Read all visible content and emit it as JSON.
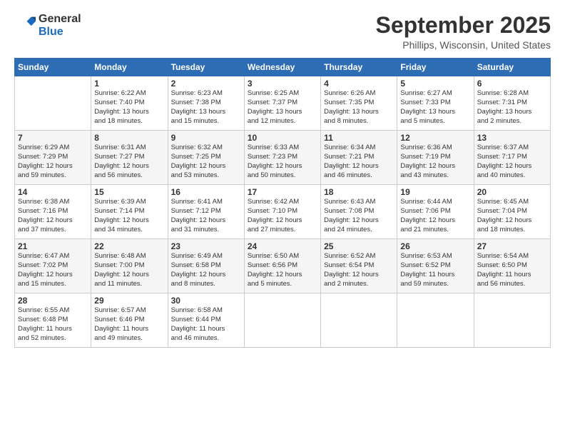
{
  "header": {
    "logo_general": "General",
    "logo_blue": "Blue",
    "month_title": "September 2025",
    "location": "Phillips, Wisconsin, United States"
  },
  "days_of_week": [
    "Sunday",
    "Monday",
    "Tuesday",
    "Wednesday",
    "Thursday",
    "Friday",
    "Saturday"
  ],
  "weeks": [
    [
      {
        "day": "",
        "info": ""
      },
      {
        "day": "1",
        "info": "Sunrise: 6:22 AM\nSunset: 7:40 PM\nDaylight: 13 hours\nand 18 minutes."
      },
      {
        "day": "2",
        "info": "Sunrise: 6:23 AM\nSunset: 7:38 PM\nDaylight: 13 hours\nand 15 minutes."
      },
      {
        "day": "3",
        "info": "Sunrise: 6:25 AM\nSunset: 7:37 PM\nDaylight: 13 hours\nand 12 minutes."
      },
      {
        "day": "4",
        "info": "Sunrise: 6:26 AM\nSunset: 7:35 PM\nDaylight: 13 hours\nand 8 minutes."
      },
      {
        "day": "5",
        "info": "Sunrise: 6:27 AM\nSunset: 7:33 PM\nDaylight: 13 hours\nand 5 minutes."
      },
      {
        "day": "6",
        "info": "Sunrise: 6:28 AM\nSunset: 7:31 PM\nDaylight: 13 hours\nand 2 minutes."
      }
    ],
    [
      {
        "day": "7",
        "info": "Sunrise: 6:29 AM\nSunset: 7:29 PM\nDaylight: 12 hours\nand 59 minutes."
      },
      {
        "day": "8",
        "info": "Sunrise: 6:31 AM\nSunset: 7:27 PM\nDaylight: 12 hours\nand 56 minutes."
      },
      {
        "day": "9",
        "info": "Sunrise: 6:32 AM\nSunset: 7:25 PM\nDaylight: 12 hours\nand 53 minutes."
      },
      {
        "day": "10",
        "info": "Sunrise: 6:33 AM\nSunset: 7:23 PM\nDaylight: 12 hours\nand 50 minutes."
      },
      {
        "day": "11",
        "info": "Sunrise: 6:34 AM\nSunset: 7:21 PM\nDaylight: 12 hours\nand 46 minutes."
      },
      {
        "day": "12",
        "info": "Sunrise: 6:36 AM\nSunset: 7:19 PM\nDaylight: 12 hours\nand 43 minutes."
      },
      {
        "day": "13",
        "info": "Sunrise: 6:37 AM\nSunset: 7:17 PM\nDaylight: 12 hours\nand 40 minutes."
      }
    ],
    [
      {
        "day": "14",
        "info": "Sunrise: 6:38 AM\nSunset: 7:16 PM\nDaylight: 12 hours\nand 37 minutes."
      },
      {
        "day": "15",
        "info": "Sunrise: 6:39 AM\nSunset: 7:14 PM\nDaylight: 12 hours\nand 34 minutes."
      },
      {
        "day": "16",
        "info": "Sunrise: 6:41 AM\nSunset: 7:12 PM\nDaylight: 12 hours\nand 31 minutes."
      },
      {
        "day": "17",
        "info": "Sunrise: 6:42 AM\nSunset: 7:10 PM\nDaylight: 12 hours\nand 27 minutes."
      },
      {
        "day": "18",
        "info": "Sunrise: 6:43 AM\nSunset: 7:08 PM\nDaylight: 12 hours\nand 24 minutes."
      },
      {
        "day": "19",
        "info": "Sunrise: 6:44 AM\nSunset: 7:06 PM\nDaylight: 12 hours\nand 21 minutes."
      },
      {
        "day": "20",
        "info": "Sunrise: 6:45 AM\nSunset: 7:04 PM\nDaylight: 12 hours\nand 18 minutes."
      }
    ],
    [
      {
        "day": "21",
        "info": "Sunrise: 6:47 AM\nSunset: 7:02 PM\nDaylight: 12 hours\nand 15 minutes."
      },
      {
        "day": "22",
        "info": "Sunrise: 6:48 AM\nSunset: 7:00 PM\nDaylight: 12 hours\nand 11 minutes."
      },
      {
        "day": "23",
        "info": "Sunrise: 6:49 AM\nSunset: 6:58 PM\nDaylight: 12 hours\nand 8 minutes."
      },
      {
        "day": "24",
        "info": "Sunrise: 6:50 AM\nSunset: 6:56 PM\nDaylight: 12 hours\nand 5 minutes."
      },
      {
        "day": "25",
        "info": "Sunrise: 6:52 AM\nSunset: 6:54 PM\nDaylight: 12 hours\nand 2 minutes."
      },
      {
        "day": "26",
        "info": "Sunrise: 6:53 AM\nSunset: 6:52 PM\nDaylight: 11 hours\nand 59 minutes."
      },
      {
        "day": "27",
        "info": "Sunrise: 6:54 AM\nSunset: 6:50 PM\nDaylight: 11 hours\nand 56 minutes."
      }
    ],
    [
      {
        "day": "28",
        "info": "Sunrise: 6:55 AM\nSunset: 6:48 PM\nDaylight: 11 hours\nand 52 minutes."
      },
      {
        "day": "29",
        "info": "Sunrise: 6:57 AM\nSunset: 6:46 PM\nDaylight: 11 hours\nand 49 minutes."
      },
      {
        "day": "30",
        "info": "Sunrise: 6:58 AM\nSunset: 6:44 PM\nDaylight: 11 hours\nand 46 minutes."
      },
      {
        "day": "",
        "info": ""
      },
      {
        "day": "",
        "info": ""
      },
      {
        "day": "",
        "info": ""
      },
      {
        "day": "",
        "info": ""
      }
    ]
  ]
}
